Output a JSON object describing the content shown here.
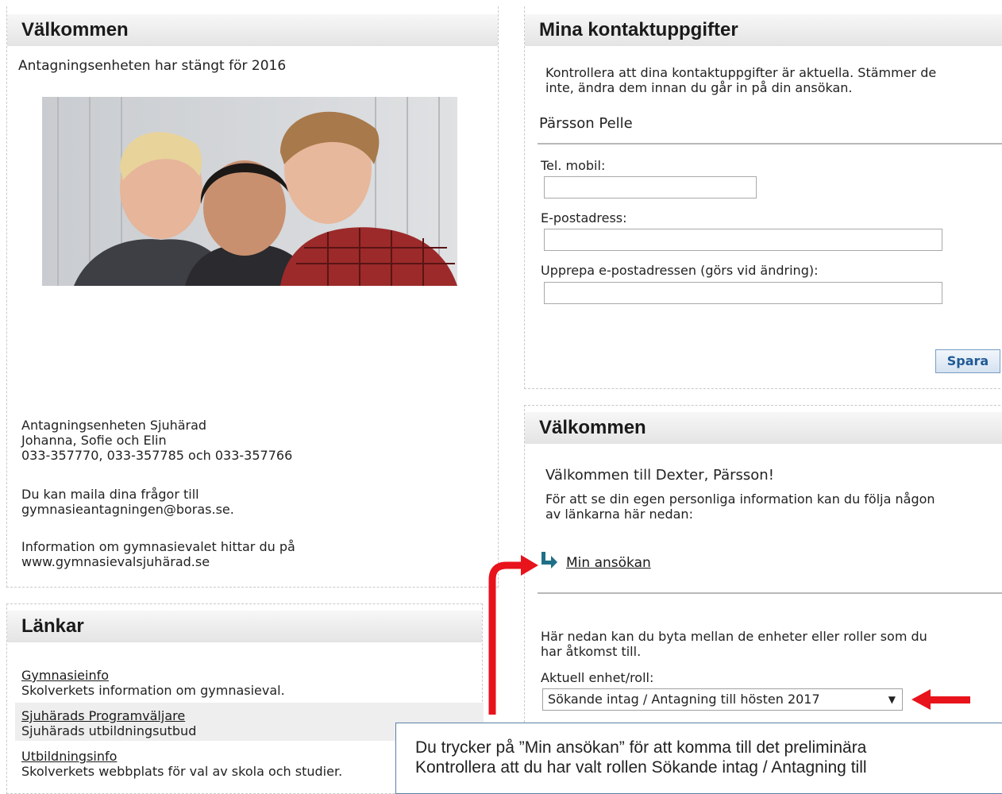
{
  "left_welcome": {
    "title": "Välkommen",
    "closed_notice": "Antagningsenheten har stängt för 2016",
    "contact_lines": [
      "Antagningsenheten Sjuhärad",
      "Johanna, Sofie och Elin",
      "033-357770, 033-357785 och 033-357766"
    ],
    "mail_lines": [
      "Du kan maila dina frågor till",
      "gymnasieantagningen@boras.se."
    ],
    "info_lines": [
      "Information om gymnasievalet hittar du på",
      "www.gymnasievalsjuhärad.se"
    ]
  },
  "links_panel": {
    "title": "Länkar",
    "items": [
      {
        "link": "Gymnasieinfo",
        "desc": "Skolverkets information om gymnasieval."
      },
      {
        "link": "Sjuhärads Programväljare",
        "desc": "Sjuhärads utbildningsutbud"
      },
      {
        "link": "Utbildningsinfo",
        "desc": "Skolverkets webbplats för val av skola och studier."
      }
    ]
  },
  "contact_panel": {
    "title": "Mina kontaktuppgifter",
    "intro_lines": [
      "Kontrollera att dina kontaktuppgifter är aktuella. Stämmer de",
      "inte, ändra dem innan du går in på din ansökan."
    ],
    "person_name": "Pärsson Pelle",
    "mobile_label": "Tel. mobil:",
    "mobile_value": "",
    "email_label": "E-postadress:",
    "email_value": "",
    "email_repeat_label": "Upprepa e-postadressen (görs vid ändring):",
    "email_repeat_value": "",
    "save_label": "Spara"
  },
  "right_welcome": {
    "title": "Välkommen",
    "greeting": "Välkommen till Dexter, Pärsson!",
    "info_lines": [
      "För att se din egen personliga information kan du följa någon",
      "av länkarna här nedan:"
    ],
    "application_link": "Min ansökan",
    "switch_lines": [
      "Här nedan kan du byta mellan de enheter eller roller som du",
      "har åtkomst till."
    ],
    "role_label": "Aktuell enhet/roll:",
    "role_selected": "Sökande intag / Antagning till hösten 2017"
  },
  "tooltip": {
    "lines": [
      "Du trycker på ”Min ansökan” för att komma till det preliminära",
      "Kontrollera att du har valt rollen Sökande intag / Antagning till"
    ]
  },
  "colors": {
    "annotation_arrow": "#e8131b",
    "link_arrow_icon": "#1f6f86"
  }
}
